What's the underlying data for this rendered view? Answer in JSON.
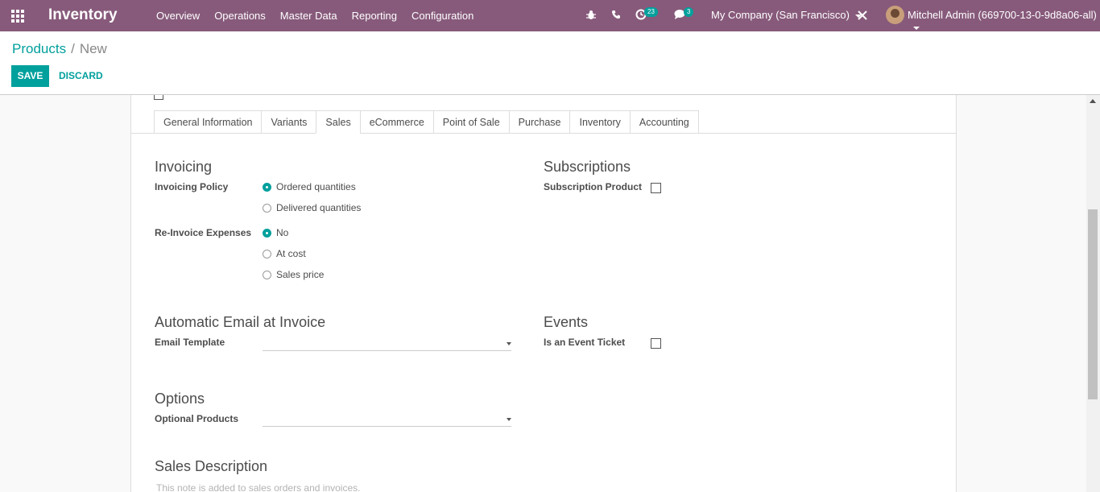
{
  "navbar": {
    "app_name": "Inventory",
    "menu": [
      "Overview",
      "Operations",
      "Master Data",
      "Reporting",
      "Configuration"
    ],
    "activity_count": "23",
    "messages_count": "3",
    "company": "My Company (San Francisco)",
    "user": "Mitchell Admin (669700-13-0-9d8a06-all)",
    "icons": [
      "bug-icon",
      "phone-icon",
      "clock-icon",
      "chat-icon",
      "close-icon"
    ]
  },
  "breadcrumb": {
    "parent": "Products",
    "separator": "/",
    "current": "New"
  },
  "buttons": {
    "save": "SAVE",
    "discard": "DISCARD"
  },
  "tabs": [
    "General Information",
    "Variants",
    "Sales",
    "eCommerce",
    "Point of Sale",
    "Purchase",
    "Inventory",
    "Accounting"
  ],
  "active_tab": "Sales",
  "sales": {
    "invoicing": {
      "title": "Invoicing",
      "policy_label": "Invoicing Policy",
      "policy_options": [
        "Ordered quantities",
        "Delivered quantities"
      ],
      "policy_selected": "Ordered quantities",
      "reinvoice_label": "Re-Invoice Expenses",
      "reinvoice_options": [
        "No",
        "At cost",
        "Sales price"
      ],
      "reinvoice_selected": "No"
    },
    "subscriptions": {
      "title": "Subscriptions",
      "product_label": "Subscription Product",
      "checked": false
    },
    "email": {
      "title": "Automatic Email at Invoice",
      "template_label": "Email Template",
      "template_value": ""
    },
    "events": {
      "title": "Events",
      "ticket_label": "Is an Event Ticket",
      "checked": false
    },
    "options": {
      "title": "Options",
      "optional_label": "Optional Products",
      "optional_value": ""
    },
    "description": {
      "title": "Sales Description",
      "placeholder": "This note is added to sales orders and invoices."
    }
  },
  "colors": {
    "navbar": "#875a7b",
    "accent": "#00a09d"
  }
}
